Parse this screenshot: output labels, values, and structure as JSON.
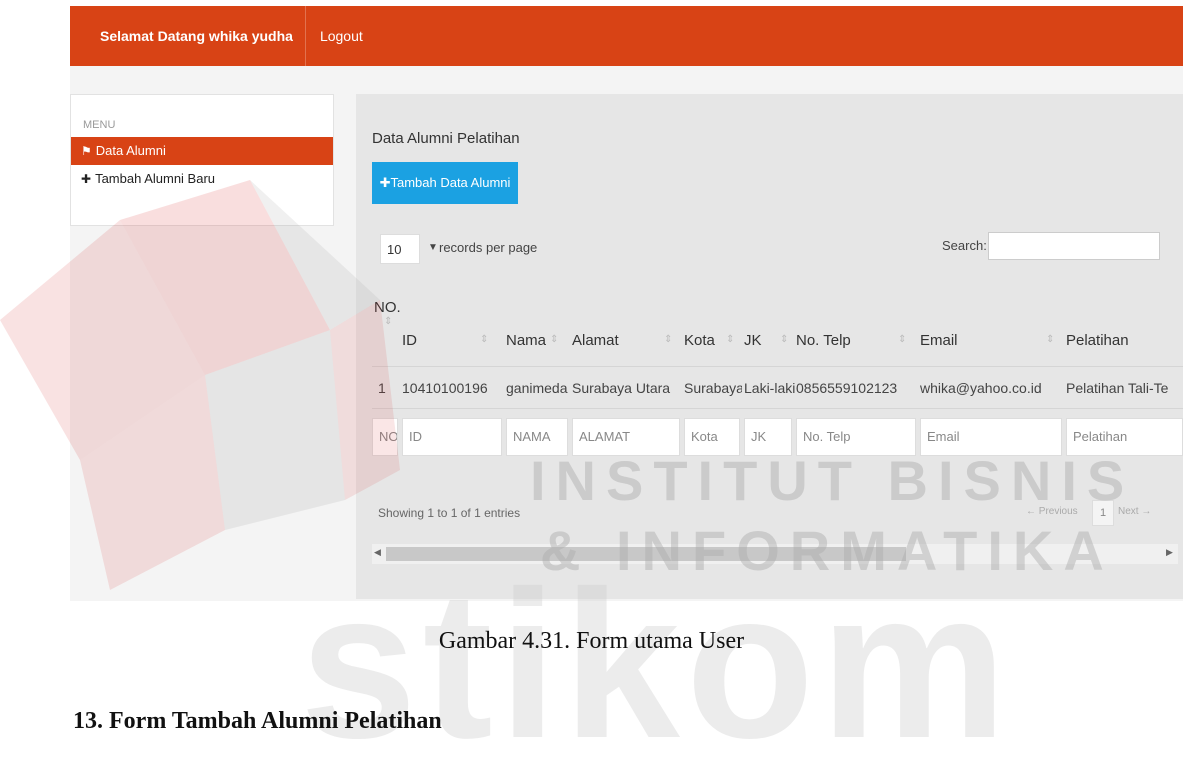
{
  "navbar": {
    "welcome": "Selamat Datang whika yudha",
    "logout": "Logout",
    "color": "#d84315"
  },
  "sidebar": {
    "menu_label": "MENU",
    "items": [
      {
        "icon": "home-icon",
        "glyph": "⚑",
        "label": "Data Alumni",
        "active": true
      },
      {
        "icon": "plus-icon",
        "glyph": "✚",
        "label": "Tambah Alumni Baru",
        "active": false
      }
    ]
  },
  "main": {
    "title": "Data Alumni Pelatihan",
    "add_button": {
      "glyph": "✚",
      "label": "Tambah Data Alumni",
      "color": "#1ba1e2"
    },
    "length": {
      "value": "10",
      "label": "records per page"
    },
    "search": {
      "label": "Search:",
      "value": ""
    },
    "no_label": "NO.",
    "columns": [
      "ID",
      "Nama",
      "Alamat",
      "Kota",
      "JK",
      "No. Telp",
      "Email",
      "Pelatihan"
    ],
    "rows": [
      [
        "1",
        "10410100196",
        "ganimeda",
        "Surabaya Utara",
        "Surabaya",
        "Laki-laki",
        "0856559102123",
        "whika@yahoo.co.id",
        "Pelatihan Tali-Te"
      ]
    ],
    "filters": [
      "NO",
      "ID",
      "NAMA",
      "ALAMAT",
      "Kota",
      "JK",
      "No. Telp",
      "Email",
      "Pelatihan"
    ],
    "info": "Showing 1 to 1 of 1 entries",
    "pagination": {
      "prev": "← Previous",
      "page": "1",
      "next": "Next →"
    }
  },
  "watermark": {
    "line1": "INSTITUT BISNIS",
    "line2": "& INFORMATIKA",
    "brand": "stikom"
  },
  "caption": "Gambar 4.31. Form utama User",
  "heading": "13. Form Tambah Alumni Pelatihan"
}
